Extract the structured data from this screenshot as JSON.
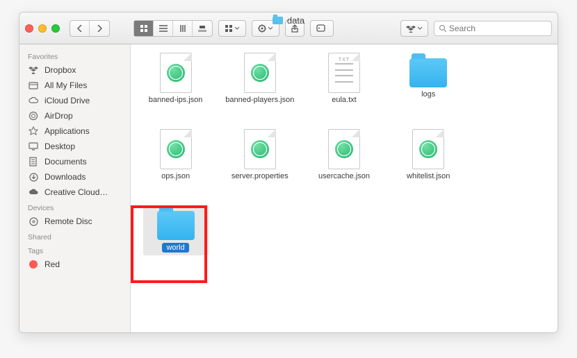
{
  "window": {
    "title": "data"
  },
  "toolbar": {
    "search_placeholder": "Search"
  },
  "sidebar": {
    "sections": {
      "favorites": "Favorites",
      "devices": "Devices",
      "shared": "Shared",
      "tags": "Tags"
    },
    "favorites": [
      {
        "label": "Dropbox"
      },
      {
        "label": "All My Files"
      },
      {
        "label": "iCloud Drive"
      },
      {
        "label": "AirDrop"
      },
      {
        "label": "Applications"
      },
      {
        "label": "Desktop"
      },
      {
        "label": "Documents"
      },
      {
        "label": "Downloads"
      },
      {
        "label": "Creative Cloud…"
      }
    ],
    "devices": [
      {
        "label": "Remote Disc"
      }
    ],
    "tags": [
      {
        "label": "Red",
        "color": "#ff5a52"
      }
    ]
  },
  "files": [
    {
      "name": "banned-ips.json",
      "kind": "json"
    },
    {
      "name": "banned-players.json",
      "kind": "json"
    },
    {
      "name": "eula.txt",
      "kind": "txt"
    },
    {
      "name": "logs",
      "kind": "folder"
    },
    {
      "name": "ops.json",
      "kind": "json"
    },
    {
      "name": "server.properties",
      "kind": "json"
    },
    {
      "name": "usercache.json",
      "kind": "json"
    },
    {
      "name": "whitelist.json",
      "kind": "json"
    },
    {
      "name": "world",
      "kind": "folder",
      "selected": true,
      "highlighted": true
    }
  ]
}
